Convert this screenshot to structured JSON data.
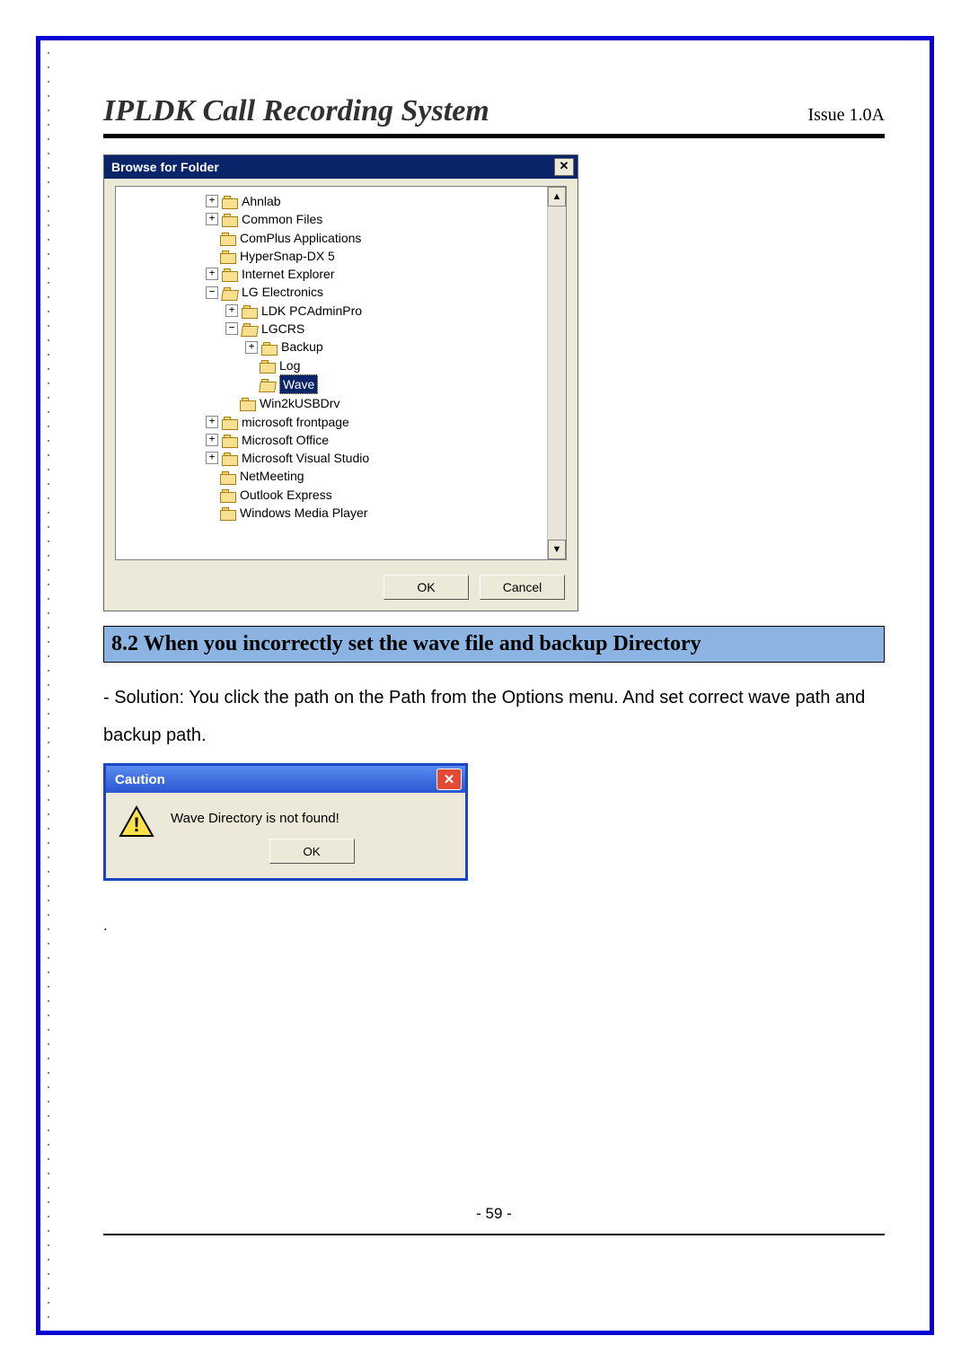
{
  "header": {
    "title": "IPLDK Call Recording System",
    "issue": "Issue 1.0A"
  },
  "bff": {
    "title": "Browse for Folder",
    "ok": "OK",
    "cancel": "Cancel",
    "nodes": {
      "n0": "Ahnlab",
      "n1": "Common Files",
      "n2": "ComPlus Applications",
      "n3": "HyperSnap-DX 5",
      "n4": "Internet Explorer",
      "n5": "LG Electronics",
      "n6": "LDK PCAdminPro",
      "n7": "LGCRS",
      "n8": "Backup",
      "n9": "Log",
      "n10": "Wave",
      "n11": "Win2kUSBDrv",
      "n12": "microsoft frontpage",
      "n13": "Microsoft Office",
      "n14": "Microsoft Visual Studio",
      "n15": "NetMeeting",
      "n16": "Outlook Express",
      "n17": "Windows Media Player"
    }
  },
  "section": {
    "heading": "8.2 When you incorrectly set the wave file and backup Directory"
  },
  "body": {
    "text": "- Solution: You click the path on the Path from the Options menu. And set correct wave path and backup path."
  },
  "caution": {
    "title": "Caution",
    "message": "Wave Directory is not found!",
    "ok": "OK"
  },
  "footer": {
    "page": "- 59 -",
    "dot": "."
  }
}
